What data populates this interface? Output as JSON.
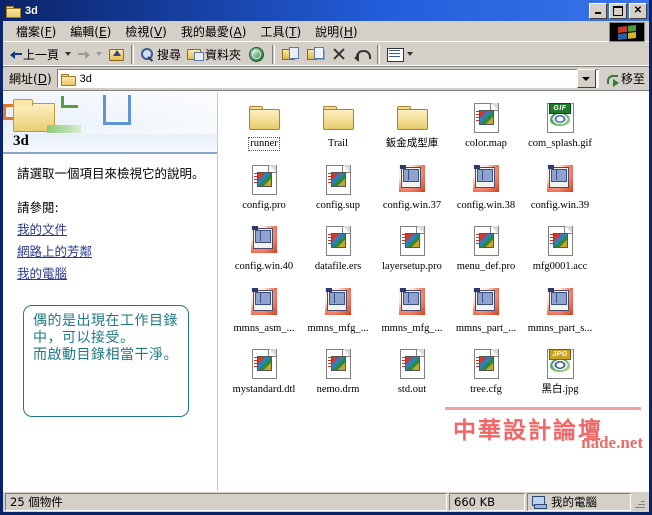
{
  "window": {
    "title": "3d",
    "icon": "folder-icon",
    "buttons": {
      "minimize": "_",
      "maximize": "□",
      "close": "✕"
    }
  },
  "menu": {
    "items": [
      {
        "label": "檔案(F)"
      },
      {
        "label": "編輯(E)"
      },
      {
        "label": "檢視(V)"
      },
      {
        "label": "我的最愛(A)"
      },
      {
        "label": "工具(T)"
      },
      {
        "label": "說明(H)"
      }
    ],
    "logo": "windows-flag-icon"
  },
  "toolbar": {
    "back_label": "上一頁",
    "forward_label": "",
    "up_label": "",
    "search_label": "搜尋",
    "folders_label": "資料夾",
    "history_label": "",
    "move_to_label": "",
    "copy_to_label": "",
    "delete_label": "",
    "undo_label": "",
    "views_label": ""
  },
  "address": {
    "label": "網址(D)",
    "value": "3d",
    "icon": "folder-icon",
    "go_label": "移至"
  },
  "task_pane": {
    "header_title": "3d",
    "hint": "請選取一個項目來檢視它的說明。",
    "see_also_label": "請參閱:",
    "links": [
      {
        "label": "我的文件"
      },
      {
        "label": "網路上的芳鄰"
      },
      {
        "label": "我的電腦"
      }
    ],
    "annotation": "偶的是出現在工作目錄中，可以接受。\n而啟動目錄相當干淨。"
  },
  "files": [
    {
      "name": "runner",
      "icon": "folder-icon",
      "focused": true
    },
    {
      "name": "Trail",
      "icon": "folder-icon",
      "focused": false
    },
    {
      "name": "鈑金成型庫",
      "icon": "folder-icon",
      "focused": false
    },
    {
      "name": "color.map",
      "icon": "document-icon",
      "focused": false
    },
    {
      "name": "com_splash.gif",
      "icon": "gif-image-icon",
      "focused": false
    },
    {
      "name": "config.pro",
      "icon": "document-icon",
      "focused": false
    },
    {
      "name": "config.sup",
      "icon": "document-icon",
      "focused": false
    },
    {
      "name": "config.win.37",
      "icon": "window-file-icon",
      "focused": false
    },
    {
      "name": "config.win.38",
      "icon": "window-file-icon",
      "focused": false
    },
    {
      "name": "config.win.39",
      "icon": "window-file-icon",
      "focused": false
    },
    {
      "name": "config.win.40",
      "icon": "window-file-icon",
      "focused": false
    },
    {
      "name": "datafile.ers",
      "icon": "document-icon",
      "focused": false
    },
    {
      "name": "layersetup.pro",
      "icon": "document-icon",
      "focused": false
    },
    {
      "name": "menu_def.pro",
      "icon": "document-icon",
      "focused": false
    },
    {
      "name": "mfg0001.acc",
      "icon": "document-icon",
      "focused": false
    },
    {
      "name": "mmns_asm_...",
      "icon": "window-file-icon",
      "focused": false
    },
    {
      "name": "mmns_mfg_...",
      "icon": "window-file-icon",
      "focused": false
    },
    {
      "name": "mmns_mfg_...",
      "icon": "window-file-icon",
      "focused": false
    },
    {
      "name": "mmns_part_...",
      "icon": "window-file-icon",
      "focused": false
    },
    {
      "name": "mmns_part_s...",
      "icon": "window-file-icon",
      "focused": false
    },
    {
      "name": "mystandard.dtl",
      "icon": "document-icon",
      "focused": false
    },
    {
      "name": "nemo.drm",
      "icon": "document-icon",
      "focused": false
    },
    {
      "name": "std.out",
      "icon": "document-icon",
      "focused": false
    },
    {
      "name": "tree.cfg",
      "icon": "document-icon",
      "focused": false
    },
    {
      "name": "黑白.jpg",
      "icon": "jpg-image-icon",
      "focused": false
    }
  ],
  "status_bar": {
    "item_count": "25 個物件",
    "size": "660 KB",
    "zone": "我的電腦"
  },
  "watermark": {
    "chinese": "中華設計論壇",
    "english": "nade.net"
  },
  "colors": {
    "title_gradient_start": "#0a246a",
    "title_gradient_end": "#3a74e8",
    "chrome": "#d4d0c8",
    "link": "#2b3a8f",
    "annotation": "#1f7a86",
    "watermark": "#f05a5a"
  }
}
